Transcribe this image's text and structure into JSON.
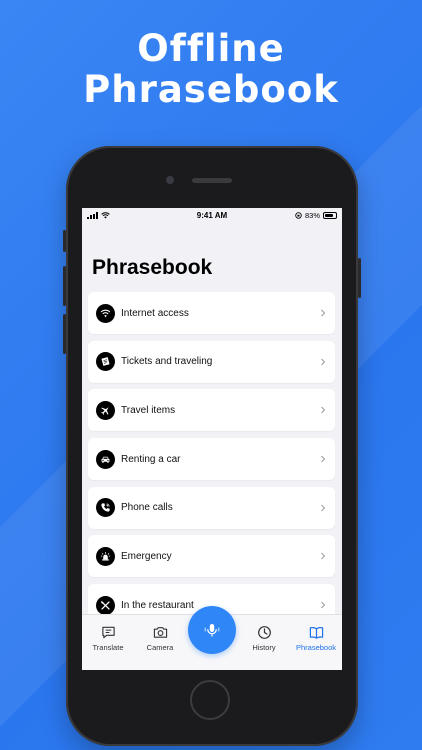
{
  "headline": {
    "line1": "Offline",
    "line2": "Phrasebook"
  },
  "status_bar": {
    "time": "9:41 AM",
    "battery": "83%",
    "battery_level": 0.83
  },
  "page": {
    "title": "Phrasebook"
  },
  "categories": [
    {
      "label": "Internet access",
      "icon": "wifi-icon"
    },
    {
      "label": "Tickets and traveling",
      "icon": "ticket-icon"
    },
    {
      "label": "Travel items",
      "icon": "airplane-icon"
    },
    {
      "label": "Renting a car",
      "icon": "car-icon"
    },
    {
      "label": "Phone calls",
      "icon": "phone-icon"
    },
    {
      "label": "Emergency",
      "icon": "siren-icon"
    },
    {
      "label": "In the restaurant",
      "icon": "cutlery-icon"
    }
  ],
  "tabbar": {
    "translate": "Translate",
    "camera": "Camera",
    "history": "History",
    "phrasebook": "Phrasebook",
    "active": "phrasebook"
  },
  "colors": {
    "background": "#2f7cf0",
    "accent": "#1f72e8",
    "mic": "#2f86f6"
  }
}
